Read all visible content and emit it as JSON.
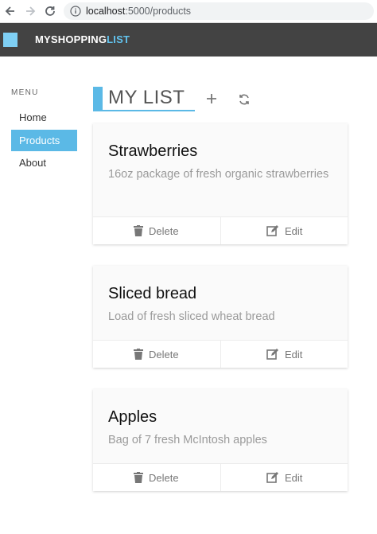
{
  "browser": {
    "url_host": "localhost",
    "url_path": ":5000/products"
  },
  "header": {
    "brand_my": "MY",
    "brand_shopping": "SHOPPING",
    "brand_list": "LIST",
    "logo_color": "#7fd0f5"
  },
  "sidebar": {
    "menu_label": "MENU",
    "items": [
      {
        "label": "Home",
        "active": false
      },
      {
        "label": "Products",
        "active": true
      },
      {
        "label": "About",
        "active": false
      }
    ],
    "active_color": "#5bb9e6"
  },
  "main": {
    "title": "MY LIST",
    "add_icon": "plus-icon",
    "refresh_icon": "refresh-icon"
  },
  "products": [
    {
      "name": "Strawberries",
      "description": "16oz package of fresh organic strawberries",
      "delete_label": "Delete",
      "edit_label": "Edit"
    },
    {
      "name": "Sliced bread",
      "description": "Load of fresh sliced wheat bread",
      "delete_label": "Delete",
      "edit_label": "Edit"
    },
    {
      "name": "Apples",
      "description": "Bag of 7 fresh McIntosh apples",
      "delete_label": "Delete",
      "edit_label": "Edit"
    }
  ]
}
